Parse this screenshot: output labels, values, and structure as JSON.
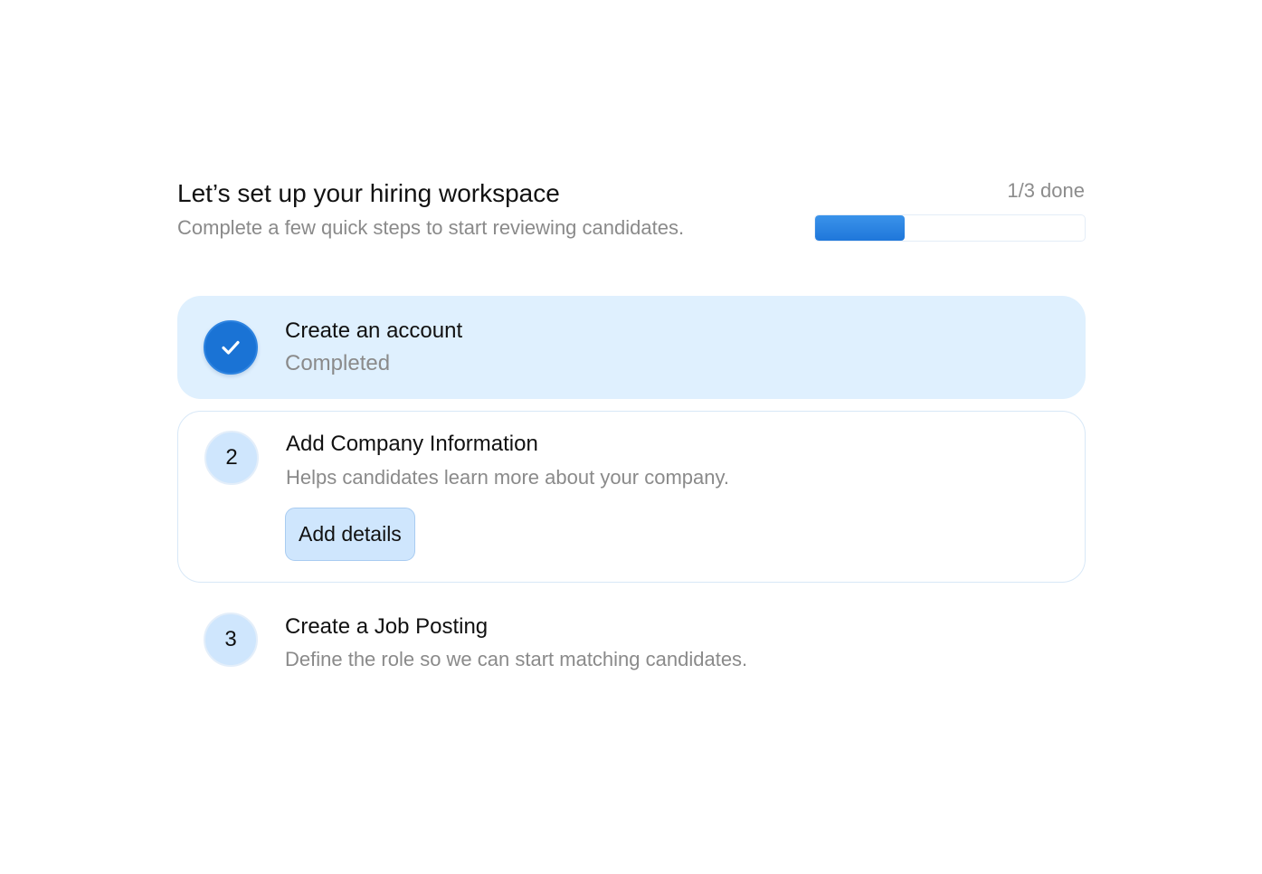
{
  "header": {
    "title": "Let’s set up your hiring workspace",
    "subtitle": "Complete a few quick steps to start reviewing candidates.",
    "progress_label": "1/3 done",
    "progress_fraction": 0.333
  },
  "colors": {
    "accent": "#1a73d5",
    "accent_light": "#cfe6fd",
    "completed_bg": "#dff0fe",
    "muted_text": "#8a8a8a"
  },
  "steps": [
    {
      "status": "completed",
      "icon": "check-icon",
      "title": "Create an account",
      "description": "Completed"
    },
    {
      "status": "active",
      "number": "2",
      "title": "Add Company Information",
      "description": "Helps candidates learn more about your company.",
      "action_label": "Add details"
    },
    {
      "status": "pending",
      "number": "3",
      "title": "Create a Job Posting",
      "description": "Define the role so we can start matching candidates."
    }
  ]
}
